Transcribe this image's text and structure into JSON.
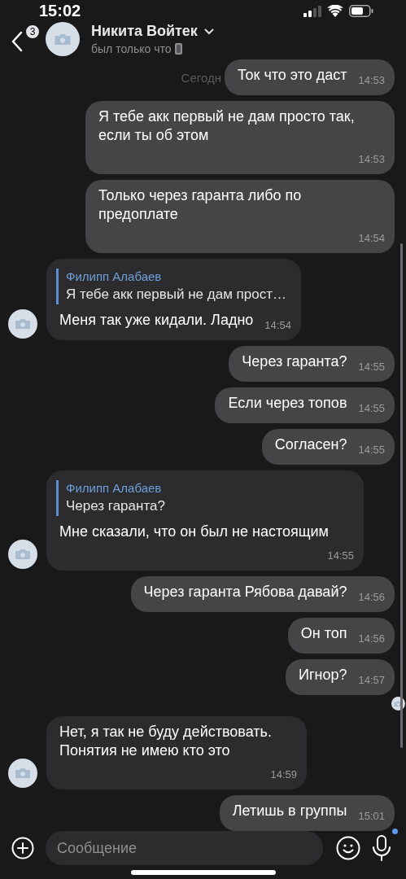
{
  "status_bar": {
    "time": "15:02"
  },
  "header": {
    "unread_count": "3",
    "name": "Никита Войтек",
    "status": "был только что"
  },
  "date_label": "Сегодн",
  "messages": [
    {
      "kind": "out",
      "text": "Ток что это даст",
      "time": "14:53"
    },
    {
      "kind": "out",
      "text": "Я тебе акк первый не дам просто так, если ты об этом",
      "time": "14:53"
    },
    {
      "kind": "out",
      "text": "Только через гаранта либо по предоплате",
      "time": "14:54"
    },
    {
      "kind": "in",
      "quote": {
        "author": "Филипп Алабаев",
        "text": "Я тебе акк первый не дам прост…"
      },
      "text": "Меня так уже кидали. Ладно",
      "time": "14:54"
    },
    {
      "kind": "out",
      "text": "Через гаранта?",
      "time": "14:55"
    },
    {
      "kind": "out",
      "text": "Если через топов",
      "time": "14:55"
    },
    {
      "kind": "out",
      "text": "Согласен?",
      "time": "14:55"
    },
    {
      "kind": "in",
      "quote": {
        "author": "Филипп Алабаев",
        "text": "Через гаранта?"
      },
      "text": "Мне сказали, что он был не настоящим",
      "time": "14:55"
    },
    {
      "kind": "out",
      "text": "Через гаранта Рябова давай?",
      "time": "14:56"
    },
    {
      "kind": "out",
      "text": "Он топ",
      "time": "14:56"
    },
    {
      "kind": "out",
      "text": "Игнор?",
      "time": "14:57",
      "read_by_avatar": true
    },
    {
      "kind": "in",
      "text": "Нет, я так не буду действовать. Понятия не имею кто это",
      "time": "14:59"
    },
    {
      "kind": "out",
      "text": "Летишь в группы",
      "time": "15:01",
      "unread": true
    }
  ],
  "composer": {
    "placeholder": "Сообщение"
  }
}
